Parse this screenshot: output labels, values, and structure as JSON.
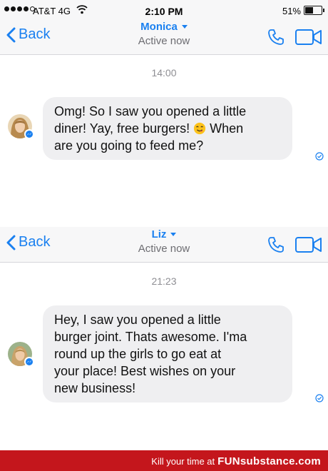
{
  "status": {
    "carrier": "AT&T 4G",
    "time": "2:10 PM",
    "battery_pct": "51%",
    "battery_level": 0.51
  },
  "conversations": [
    {
      "back_label": "Back",
      "contact_name": "Monica",
      "contact_status": "Active now",
      "timestamp": "14:00",
      "message_lines": [
        "Omg! So I saw you opened a little",
        "diner! Yay, free burgers!",
        "are you going to feed me?"
      ],
      "inline_after_emoji": "When",
      "emoji": "yum-face-emoji"
    },
    {
      "back_label": "Back",
      "contact_name": "Liz",
      "contact_status": "Active now",
      "timestamp": "21:23",
      "message_lines": [
        "Hey, I saw you opened a little",
        "burger joint. Thats awesome. I'ma",
        "round up the girls to go eat at",
        "your place! Best wishes on your",
        "new business!"
      ]
    }
  ],
  "footer": {
    "prefix": "Kill your time at",
    "brand": "FUNsubstance.com"
  },
  "colors": {
    "accent": "#1a80f0",
    "bubble": "#efeff1",
    "banner": "#c4161c"
  }
}
